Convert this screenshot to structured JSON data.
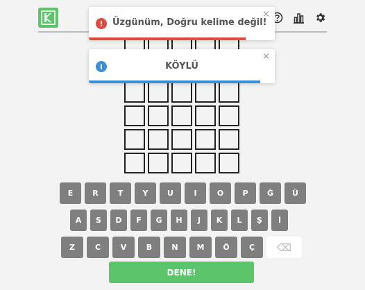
{
  "header": {
    "icons": [
      "logo-icon",
      "help-icon",
      "stats-icon",
      "settings-icon"
    ]
  },
  "toasts": [
    {
      "type": "error",
      "message": "Üzgünüm, Doğru kelime değil!",
      "close": "×",
      "icon": "!",
      "color": "#e04a3f"
    },
    {
      "type": "info",
      "message": "KÖYLÜ",
      "close": "×",
      "icon": "i",
      "color": "#3c8ed8"
    }
  ],
  "keyboard": {
    "row1": [
      "E",
      "R",
      "T",
      "Y",
      "U",
      "I",
      "O",
      "P",
      "Ğ",
      "Ü"
    ],
    "row2": [
      "A",
      "S",
      "D",
      "F",
      "G",
      "H",
      "J",
      "K",
      "L",
      "Ş",
      "İ"
    ],
    "row3": [
      "Z",
      "C",
      "V",
      "B",
      "N",
      "M",
      "Ö",
      "Ç",
      "⌫"
    ],
    "submit_label": "DENE!"
  },
  "colors": {
    "accent": "#5cc46a",
    "key": "#7f7f7f",
    "background": "#f3f3f3"
  }
}
